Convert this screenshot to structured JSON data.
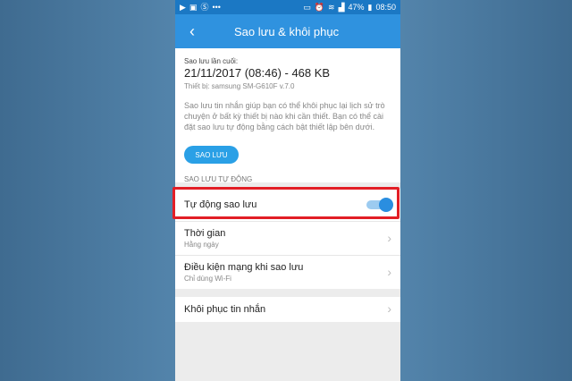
{
  "status_bar": {
    "left_icons": [
      "video-icon",
      "image-icon",
      "skype-icon",
      "more-icon"
    ],
    "battery": "47%",
    "time": "08:50"
  },
  "app_bar": {
    "title": "Sao lưu & khôi phục"
  },
  "backup_info": {
    "last_label": "Sao lưu lần cuối:",
    "last_value": "21/11/2017 (08:46) - 468 KB",
    "device": "Thiết bị: samsung SM-G610F v.7.0",
    "description": "Sao lưu tin nhắn giúp bạn có thể khôi phục lại lịch sử trò chuyện ở bất kỳ thiết bị nào khi cần thiết. Bạn có thể cài đặt sao lưu tự động bằng cách bật thiết lập bên dưới.",
    "button_label": "SAO LƯU"
  },
  "auto_section": {
    "header": "SAO LƯU TỰ ĐỘNG",
    "auto_backup": {
      "label": "Tự động sao lưu",
      "enabled": true
    },
    "time": {
      "label": "Thời gian",
      "value": "Hằng ngày"
    },
    "network": {
      "label": "Điều kiện mạng khi sao lưu",
      "value": "Chỉ dùng Wi-Fi"
    }
  },
  "restore": {
    "label": "Khôi phục tin nhắn"
  },
  "colors": {
    "app_bar": "#2f92df",
    "status_bar": "#1b78c4",
    "accent": "#2aa0e6",
    "highlight": "#e21e26"
  }
}
